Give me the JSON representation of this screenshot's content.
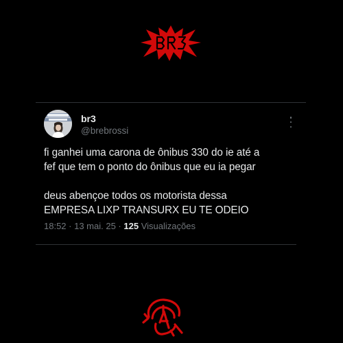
{
  "colors": {
    "background": "#000000",
    "text_primary": "#e7e9ea",
    "text_secondary": "#71767b",
    "divider": "#2f3336",
    "logo_red": "#d10a0a"
  },
  "top_logo": {
    "icon": "red-spiky-br3-logo-icon"
  },
  "bottom_logo": {
    "icon": "red-handdrawn-symbol-icon"
  },
  "tweet": {
    "avatar": {
      "icon": "user-avatar-photo"
    },
    "display_name": "br3",
    "handle": "@brebrossi",
    "more_icon": "more-options-icon",
    "text": "fi ganhei uma carona de ônibus 330 do ie até a\nfef que tem o ponto do ônibus que eu ia pegar\n\ndeus abençoe todos os motorista dessa\nEMPRESA LIXP TRANSURX EU TE ODEIO",
    "time": "18:52",
    "date": "13 mai. 25",
    "separator": " · ",
    "views_count": "125",
    "views_label": "Visualizações"
  }
}
